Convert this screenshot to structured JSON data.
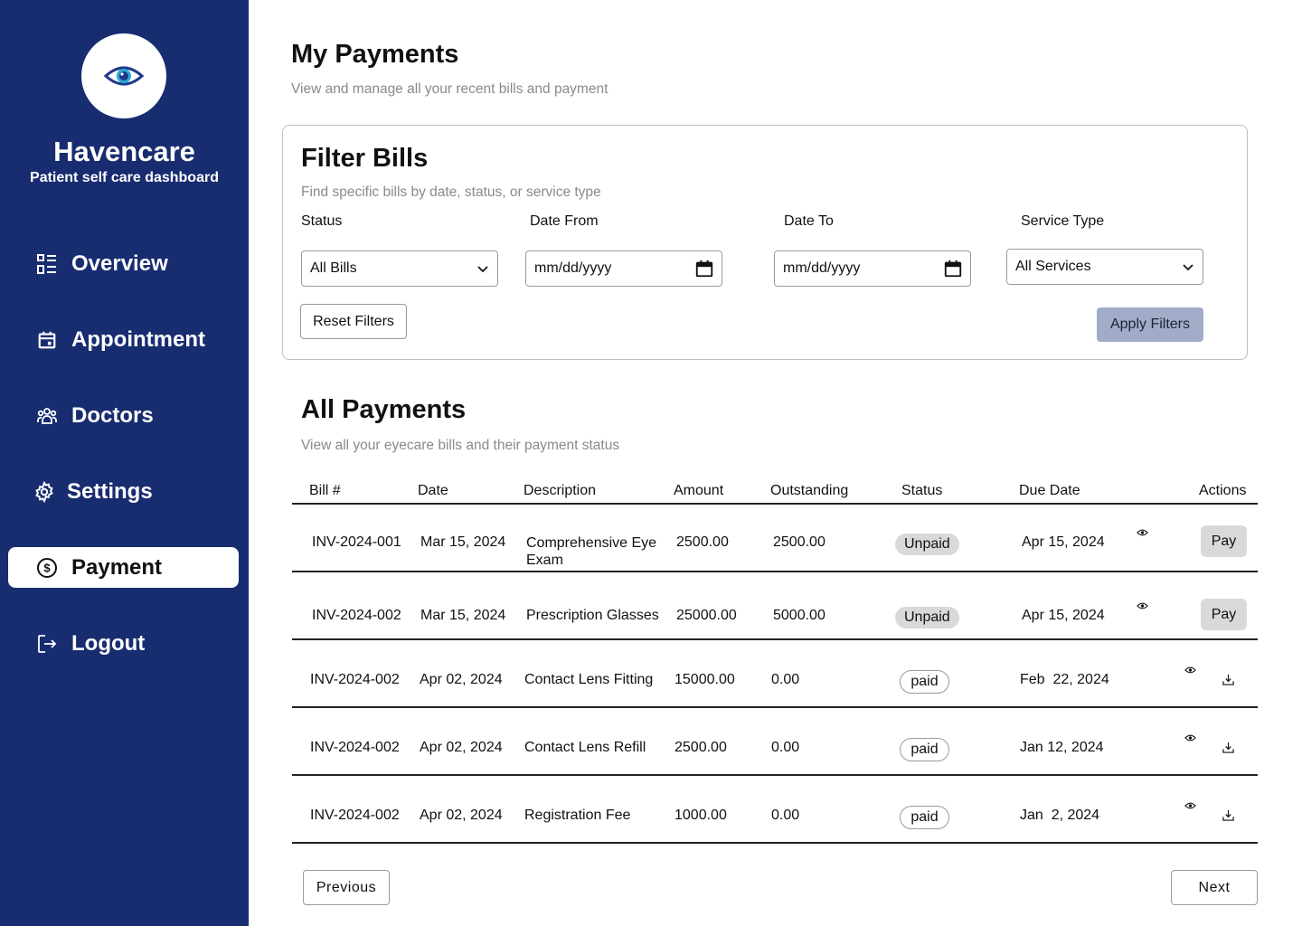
{
  "sidebar": {
    "brand_name": "Havencare",
    "brand_subtitle": "Patient self care dashboard",
    "items": [
      {
        "label": "Overview",
        "icon": "list-grid-icon"
      },
      {
        "label": "Appointment",
        "icon": "calendar-icon"
      },
      {
        "label": "Doctors",
        "icon": "users-group-icon"
      },
      {
        "label": "Settings",
        "icon": "gear-icon"
      },
      {
        "label": "Payment",
        "icon": "dollar-circle-icon",
        "active": true
      },
      {
        "label": "Logout",
        "icon": "logout-icon"
      }
    ]
  },
  "header": {
    "title": "My Payments",
    "subtitle": "View and manage all your recent bills and payment"
  },
  "filter": {
    "title": "Filter Bills",
    "subtitle": "Find specific bills by date, status, or service type",
    "status_label": "Status",
    "status_value": "All Bills",
    "date_from_label": "Date From",
    "date_from_value": "mm/dd/yyyy",
    "date_to_label": "Date To",
    "date_to_value": "mm/dd/yyyy",
    "service_label": "Service Type",
    "service_value": "All Services",
    "reset_label": "Reset Filters",
    "apply_label": "Apply Filters"
  },
  "payments": {
    "title": "All Payments",
    "subtitle": "View all your eyecare bills and their payment status",
    "columns": [
      "Bill #",
      "Date",
      "Description",
      "Amount",
      "Outstanding",
      "Status",
      "Due Date",
      "Actions"
    ],
    "rows": [
      {
        "bill": "INV-2024-001",
        "date": "Mar 15, 2024",
        "description": "Comprehensive Eye Exam",
        "amount": "2500.00",
        "outstanding": "2500.00",
        "status": "Unpaid",
        "due": "Apr 15, 2024",
        "action": "Pay"
      },
      {
        "bill": "INV-2024-002",
        "date": "Mar 15, 2024",
        "description": "Prescription Glasses",
        "amount": "25000.00",
        "outstanding": "5000.00",
        "status": "Unpaid",
        "due": "Apr 15, 2024",
        "action": "Pay"
      },
      {
        "bill": "INV-2024-002",
        "date": "Apr 02, 2024",
        "description": "Contact Lens Fitting",
        "amount": "15000.00",
        "outstanding": "0.00",
        "status": "paid",
        "due": "Feb  22, 2024"
      },
      {
        "bill": "INV-2024-002",
        "date": "Apr 02, 2024",
        "description": "Contact Lens Refill",
        "amount": "2500.00",
        "outstanding": "0.00",
        "status": "paid",
        "due": "Jan 12, 2024"
      },
      {
        "bill": "INV-2024-002",
        "date": "Apr 02, 2024",
        "description": "Registration Fee",
        "amount": "1000.00",
        "outstanding": "0.00",
        "status": "paid",
        "due": "Jan  2, 2024"
      }
    ],
    "previous_label": "Previous",
    "next_label": "Next"
  },
  "colors": {
    "sidebar_bg": "#182c70",
    "apply_button": "#a1acc9",
    "badge_grey": "#d9d9d9"
  }
}
